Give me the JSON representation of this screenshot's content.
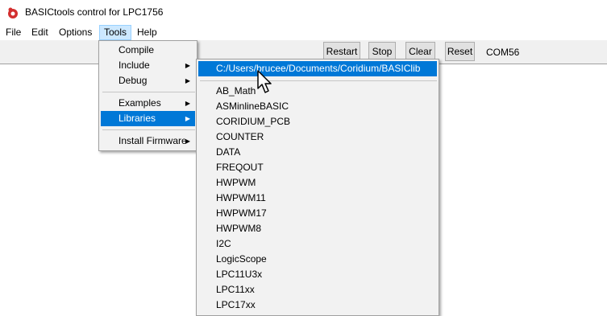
{
  "window": {
    "title": "BASICtools control for LPC1756"
  },
  "menubar": {
    "items": [
      "File",
      "Edit",
      "Options",
      "Tools",
      "Help"
    ]
  },
  "toolbar": {
    "restart_label": "Restart",
    "stop_label": "Stop",
    "clear_label": "Clear",
    "reset_label": "Reset",
    "port_label": "COM56"
  },
  "tools_menu": {
    "items": [
      "Compile",
      "Include",
      "Debug",
      "Examples",
      "Libraries",
      "Install Firmware"
    ],
    "selected": "Libraries"
  },
  "libraries_menu": {
    "path": "C:/Users/brucee/Documents/Coridium/BASIClib",
    "items": [
      "AB_Math",
      "ASMinlineBASIC",
      "CORIDIUM_PCB",
      "COUNTER",
      "DATA",
      "FREQOUT",
      "HWPWM",
      "HWPWM11",
      "HWPWM17",
      "HWPWM8",
      "I2C",
      "LogicScope",
      "LPC11U3x",
      "LPC11xx",
      "LPC17xx"
    ]
  },
  "colors": {
    "highlight": "#0078d7",
    "menu_bg": "#f2f2f2",
    "active_menu": "#cce8ff"
  },
  "icons": {
    "app": "coridium-logo-icon",
    "cursor": "mouse-pointer-icon",
    "submenu_arrow": "chevron-right-icon"
  }
}
